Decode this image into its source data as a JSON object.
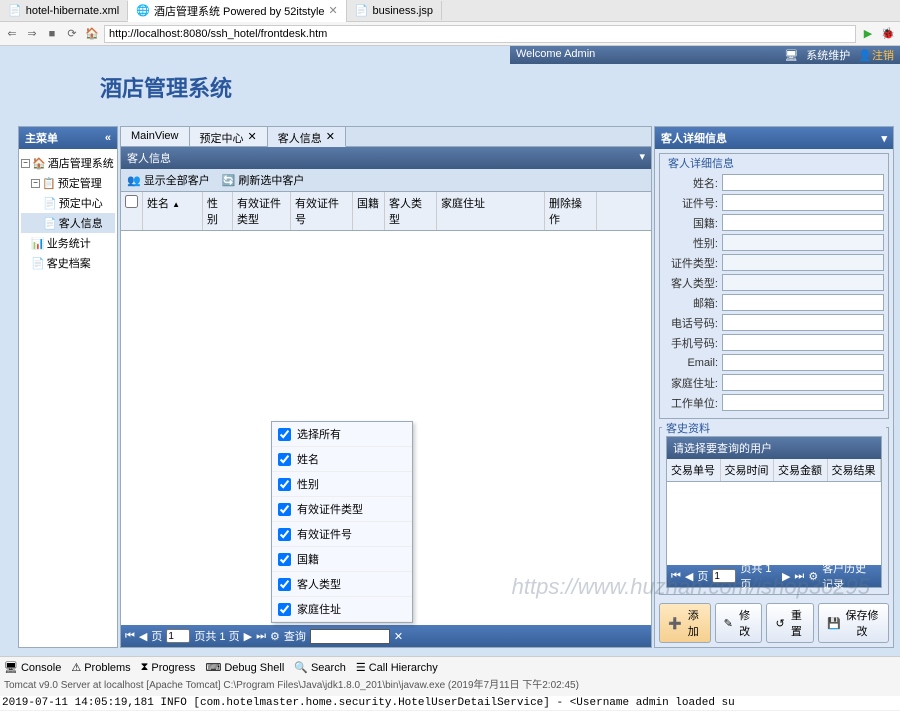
{
  "browser": {
    "tabs": [
      {
        "label": "hotel-hibernate.xml",
        "active": false
      },
      {
        "label": "酒店管理系统 Powered by 52itstyle",
        "active": true
      },
      {
        "label": "business.jsp",
        "active": false
      }
    ],
    "url": "http://localhost:8080/ssh_hotel/frontdesk.htm"
  },
  "topbar": {
    "welcome": "Welcome Admin",
    "sys_maint": "系统维护",
    "logout": "注销"
  },
  "app_title": "酒店管理系统",
  "sidebar": {
    "title": "主菜单",
    "nodes": {
      "root": "酒店管理系统",
      "reserve_mgmt": "预定管理",
      "reserve_center": "预定中心",
      "guest_info": "客人信息",
      "biz_stats": "业务统计",
      "history": "客史档案"
    }
  },
  "tabs": [
    {
      "label": "MainView",
      "active": false,
      "closable": false
    },
    {
      "label": "预定中心",
      "active": false,
      "closable": true
    },
    {
      "label": "客人信息",
      "active": true,
      "closable": true
    }
  ],
  "guest_panel": {
    "title": "客人信息",
    "toolbar": {
      "show_all": "显示全部客户",
      "refresh_current": "刷新选中客户"
    },
    "columns": {
      "name": "姓名",
      "sex": "性别",
      "card_type": "有效证件类型",
      "card_no": "有效证件号",
      "nation": "国籍",
      "guest_type": "客人类型",
      "home_addr": "家庭住址",
      "delete_op": "删除操作"
    },
    "picker": {
      "select_all": "选择所有",
      "items": [
        "姓名",
        "性别",
        "有效证件类型",
        "有效证件号",
        "国籍",
        "客人类型",
        "家庭住址"
      ]
    },
    "paging": {
      "page_label_pre": "页",
      "page_value": "1",
      "page_label_post": "页共 1 页",
      "search_label": "查询"
    }
  },
  "detail": {
    "title": "客人详细信息",
    "fieldset1_title": "客人详细信息",
    "fields": {
      "name": "姓名:",
      "card_no": "证件号:",
      "nation": "国籍:",
      "sex": "性别:",
      "card_type": "证件类型:",
      "guest_type": "客人类型:",
      "email_cn": "邮箱:",
      "phone": "电话号码:",
      "mobile": "手机号码:",
      "email_en": "Email:",
      "home_addr": "家庭住址:",
      "work_unit": "工作单位:"
    },
    "fieldset2_title": "客史资料",
    "history_title": "请选择要查询的用户",
    "history_cols": [
      "交易单号",
      "交易时间",
      "交易金额",
      "交易结果"
    ],
    "history_paging": {
      "pre": "页",
      "value": "1",
      "post": "页共 1 页",
      "no_records": "客户历史记录"
    },
    "buttons": {
      "add": "添加",
      "modify": "修改",
      "reset": "重置",
      "save": "保存修改"
    }
  },
  "ide": {
    "views": [
      "Console",
      "Problems",
      "Progress",
      "Debug Shell",
      "Search",
      "Call Hierarchy"
    ],
    "status": "Tomcat v9.0 Server at localhost [Apache Tomcat] C:\\Program Files\\Java\\jdk1.8.0_201\\bin\\javaw.exe (2019年7月11日 下午2:02:45)",
    "log": "2019-07-11 14:05:19,181 INFO [com.hotelmaster.home.security.HotelUserDetailService] - <Username admin loaded su"
  },
  "watermark": "https://www.huzhan.com/ishop30295"
}
